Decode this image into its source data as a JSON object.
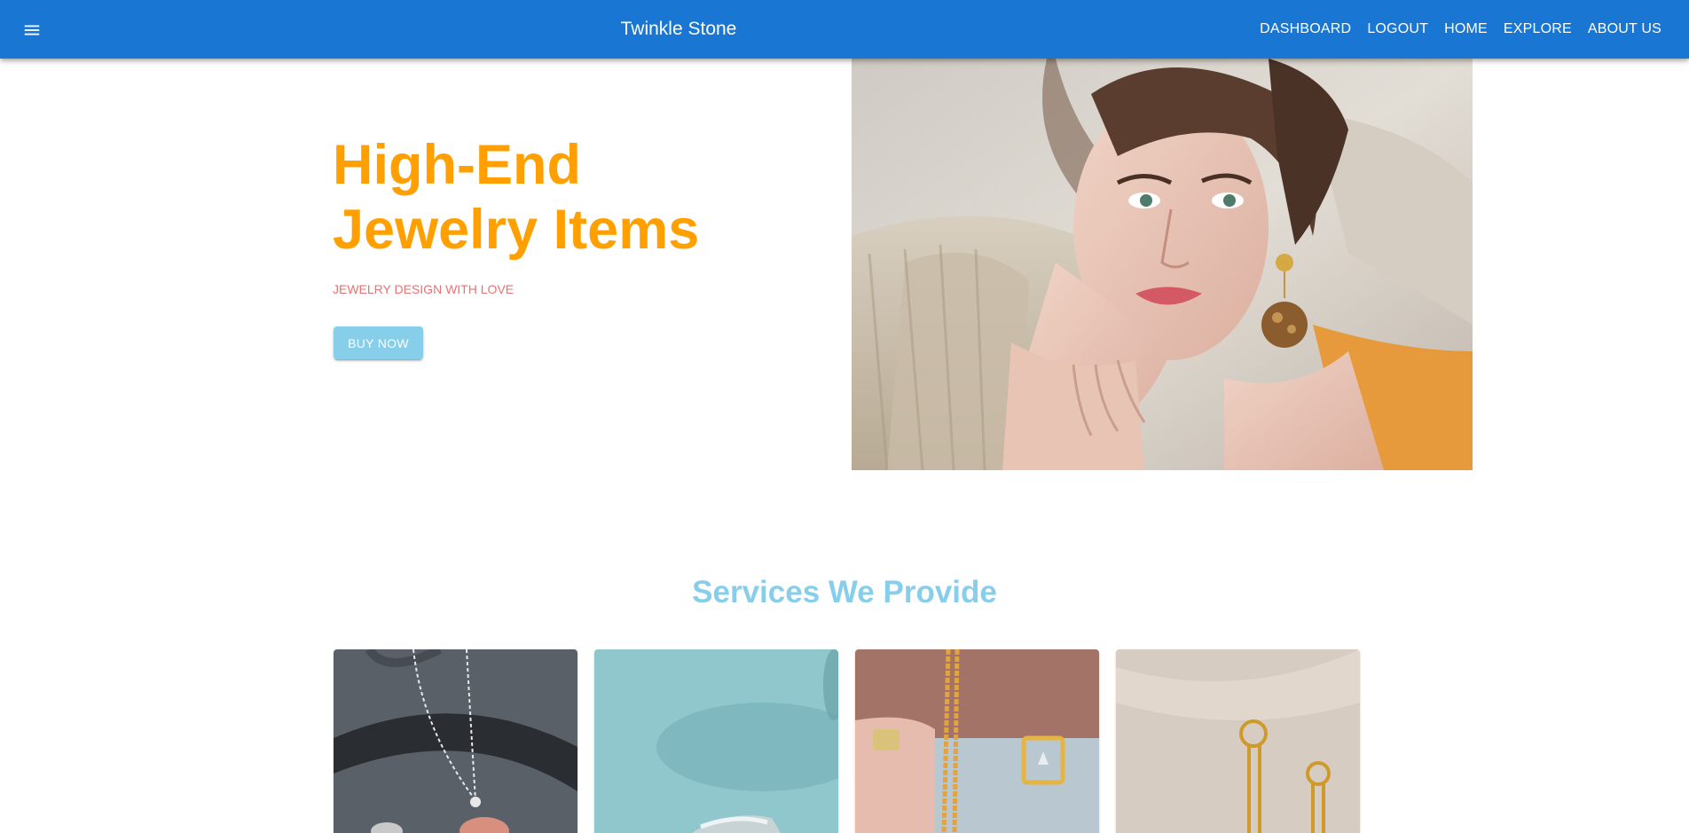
{
  "appbar": {
    "brand": "Twinkle Stone",
    "menu_icon": "hamburger-menu-icon",
    "nav": [
      "DASHBOARD",
      "LOGOUT",
      "HOME",
      "EXPLORE",
      "ABOUT US"
    ]
  },
  "hero": {
    "title_line1": "High-End",
    "title_line2": "Jewelry Items",
    "subtitle": "JEWELRY DESIGN WITH LOVE",
    "button_label": "BUY NOW"
  },
  "services": {
    "title": "Services We Provide"
  },
  "colors": {
    "appbar": "#1976d2",
    "hero_title": "#ffa000",
    "subtitle": "#e57373",
    "accent": "#87ceeb"
  }
}
